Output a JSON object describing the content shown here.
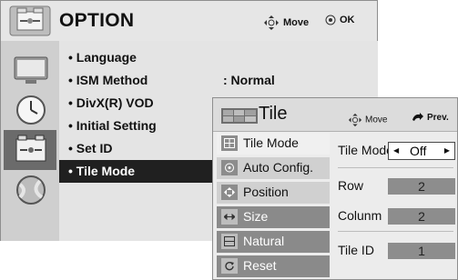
{
  "main": {
    "title": "OPTION",
    "hints": {
      "move": "Move",
      "ok": "OK"
    },
    "items": [
      {
        "label": "• Language",
        "value": ""
      },
      {
        "label": "• ISM Method",
        "value": ": Normal"
      },
      {
        "label": "• DivX(R) VOD",
        "value": ""
      },
      {
        "label": "• Initial Setting",
        "value": ""
      },
      {
        "label": "• Set ID",
        "value": ""
      },
      {
        "label": "• Tile Mode",
        "value": ""
      }
    ],
    "selected_index": 5,
    "sidebar": [
      "picture-icon",
      "clock-icon",
      "option-icon",
      "globe-icon"
    ],
    "sidebar_active_index": 2
  },
  "tile": {
    "title": "Tile",
    "hints": {
      "move": "Move",
      "prev": "Prev."
    },
    "items": [
      {
        "label": "Tile Mode",
        "icon": "grid-icon"
      },
      {
        "label": "Auto Config.",
        "icon": "target-icon"
      },
      {
        "label": "Position",
        "icon": "move-icon"
      },
      {
        "label": "Size",
        "icon": "resize-icon"
      },
      {
        "label": "Natural",
        "icon": "frame-icon"
      },
      {
        "label": "Reset",
        "icon": "reset-icon"
      }
    ],
    "settings": {
      "tile_mode": {
        "label": "Tile Mode",
        "value": "Off"
      },
      "row": {
        "label": "Row",
        "value": "2"
      },
      "column": {
        "label": "Colunm",
        "value": "2"
      },
      "tile_id": {
        "label": "Tile ID",
        "value": "1"
      }
    }
  },
  "colors": {
    "selected_bg": "#202020",
    "panel_bg": "#e4e4e4",
    "box_bg": "#8d8d8d"
  }
}
